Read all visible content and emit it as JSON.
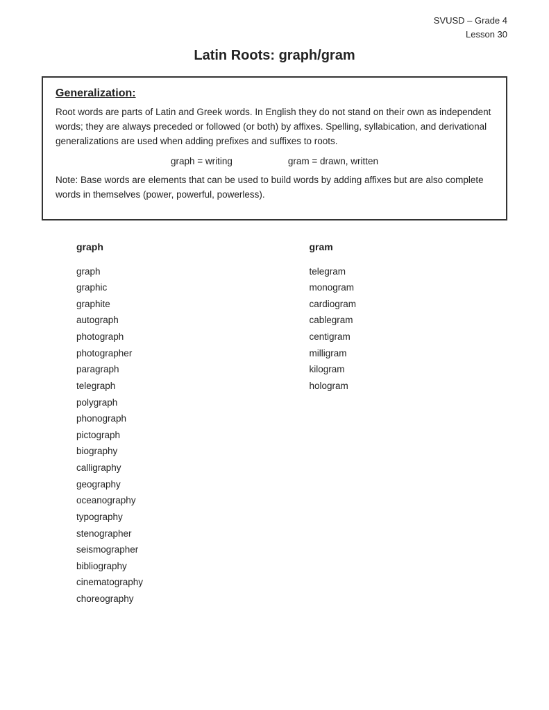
{
  "header": {
    "line1": "SVUSD – Grade 4",
    "line2": "Lesson 30"
  },
  "title": "Latin Roots: graph/gram",
  "generalization": {
    "heading": "Generalization:",
    "body": "Root words are parts of Latin and Greek words.  In English they do not stand on their own as independent words; they are always preceded or followed (or both) by affixes. Spelling, syllabication, and derivational generalizations are used when adding prefixes and suffixes to roots.",
    "equation_left": "graph = writing",
    "equation_right": "gram = drawn, written",
    "note": "Note: Base words are elements that can be used to build words by adding affixes but are also complete words in themselves (power, powerful, powerless)."
  },
  "columns": {
    "graph": {
      "header": "graph",
      "words": [
        "graph",
        "graphic",
        "graphite",
        "autograph",
        "photograph",
        "photographer",
        "paragraph",
        "telegraph",
        "polygraph",
        "phonograph",
        "pictograph",
        "biography",
        "calligraphy",
        "geography",
        "oceanography",
        "typography",
        "stenographer",
        "seismographer",
        "bibliography",
        "cinematography",
        "choreography"
      ]
    },
    "gram": {
      "header": "gram",
      "words": [
        "telegram",
        "monogram",
        "cardiogram",
        "cablegram",
        "centigram",
        "milligram",
        "kilogram",
        "hologram"
      ]
    }
  }
}
